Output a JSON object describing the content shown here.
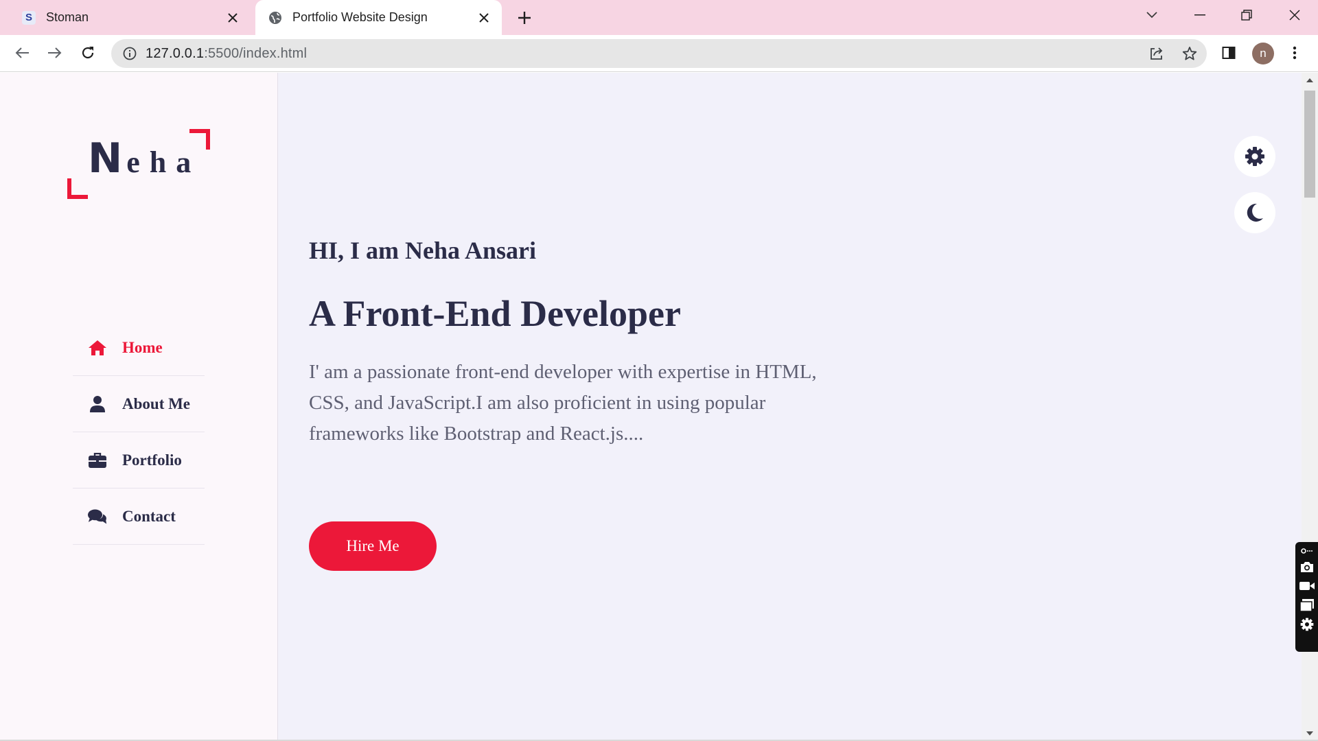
{
  "browser": {
    "tabs": [
      {
        "title": "Stoman",
        "favicon": "S",
        "active": false
      },
      {
        "title": "Portfolio Website Design",
        "favicon": "globe-icon",
        "active": true
      }
    ],
    "url_host": "127.0.0.1",
    "url_path": ":5500/index.html",
    "profile_initial": "n"
  },
  "sidebar": {
    "logo_first": "N",
    "logo_rest": "eha",
    "nav": [
      {
        "label": "Home",
        "icon": "home-icon",
        "active": true
      },
      {
        "label": "About Me",
        "icon": "user-icon",
        "active": false
      },
      {
        "label": "Portfolio",
        "icon": "briefcase-icon",
        "active": false
      },
      {
        "label": "Contact",
        "icon": "comments-icon",
        "active": false
      }
    ]
  },
  "main": {
    "greeting": "HI, I am Neha Ansari",
    "role": "A Front-End Developer",
    "bio": "I' am a passionate front-end developer with expertise in HTML, CSS, and JavaScript.I am also proficient in using popular frameworks like Bootstrap and React.js....",
    "cta": "Hire Me"
  },
  "colors": {
    "accent": "#ec1839",
    "text": "#2b2c48",
    "sidebar_bg": "#fcf7fb",
    "main_bg": "#f2f1fa",
    "tabstrip_bg": "#f7d5e3"
  }
}
